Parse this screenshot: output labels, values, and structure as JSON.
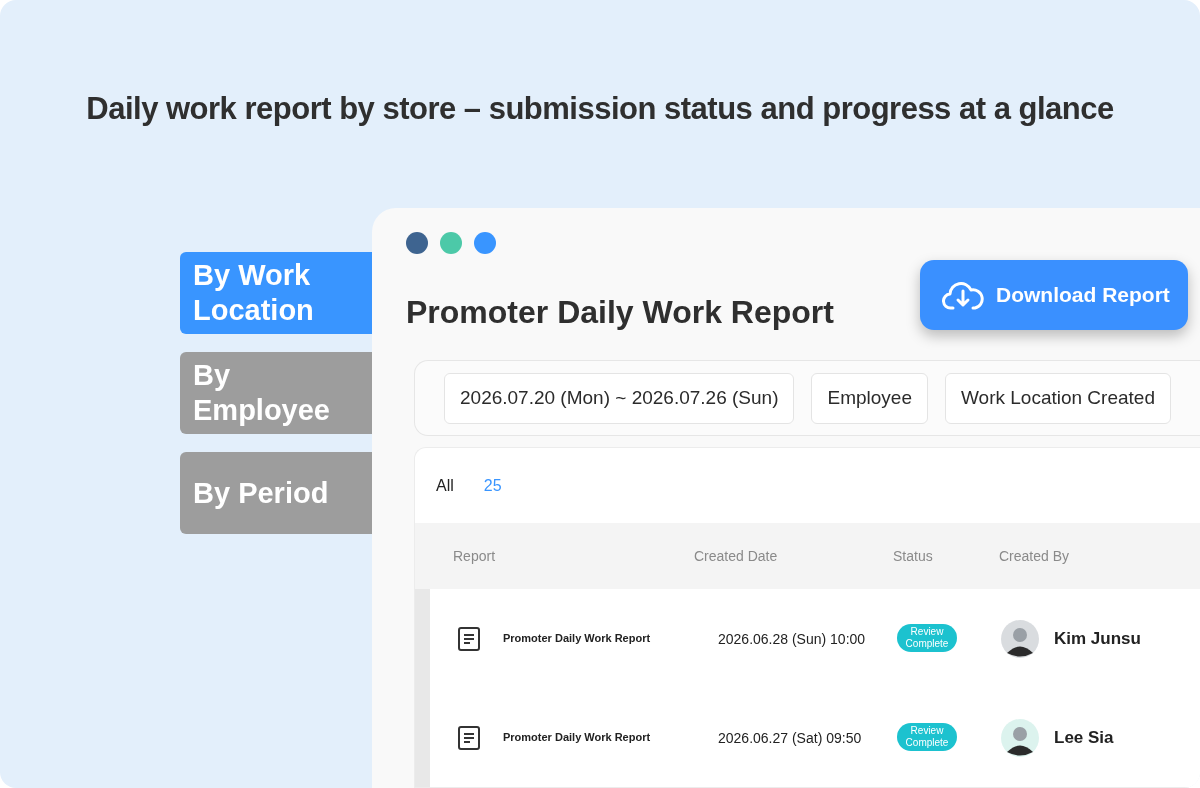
{
  "headline": "Daily work report by store – submission status and progress at a glance",
  "side_tabs": [
    {
      "label": "By Work Location",
      "selected": true
    },
    {
      "label": "By Employee",
      "selected": false
    },
    {
      "label": "By Period",
      "selected": false
    }
  ],
  "window": {
    "title": "Promoter Daily Work Report",
    "dots": [
      {
        "color": "#3e6490"
      },
      {
        "color": "#4cc9a8"
      },
      {
        "color": "#3995ff"
      }
    ]
  },
  "download_button": "Download Report",
  "filters": [
    "2026.07.20 (Mon) ~ 2026.07.26 (Sun)",
    "Employee",
    "Work Location Created"
  ],
  "count": {
    "label": "All",
    "value": "25"
  },
  "table": {
    "columns": [
      "Report",
      "Created Date",
      "Status",
      "Created By"
    ],
    "rows": [
      {
        "report": "Promoter Daily Work Report",
        "date": "2026.06.28 (Sun) 10:00",
        "status": "Review Complete",
        "author": "Kim Junsu"
      },
      {
        "report": "Promoter Daily Work Report",
        "date": "2026.06.27 (Sat) 09:50",
        "status": "Review Complete",
        "author": "Lee Sia"
      }
    ]
  }
}
